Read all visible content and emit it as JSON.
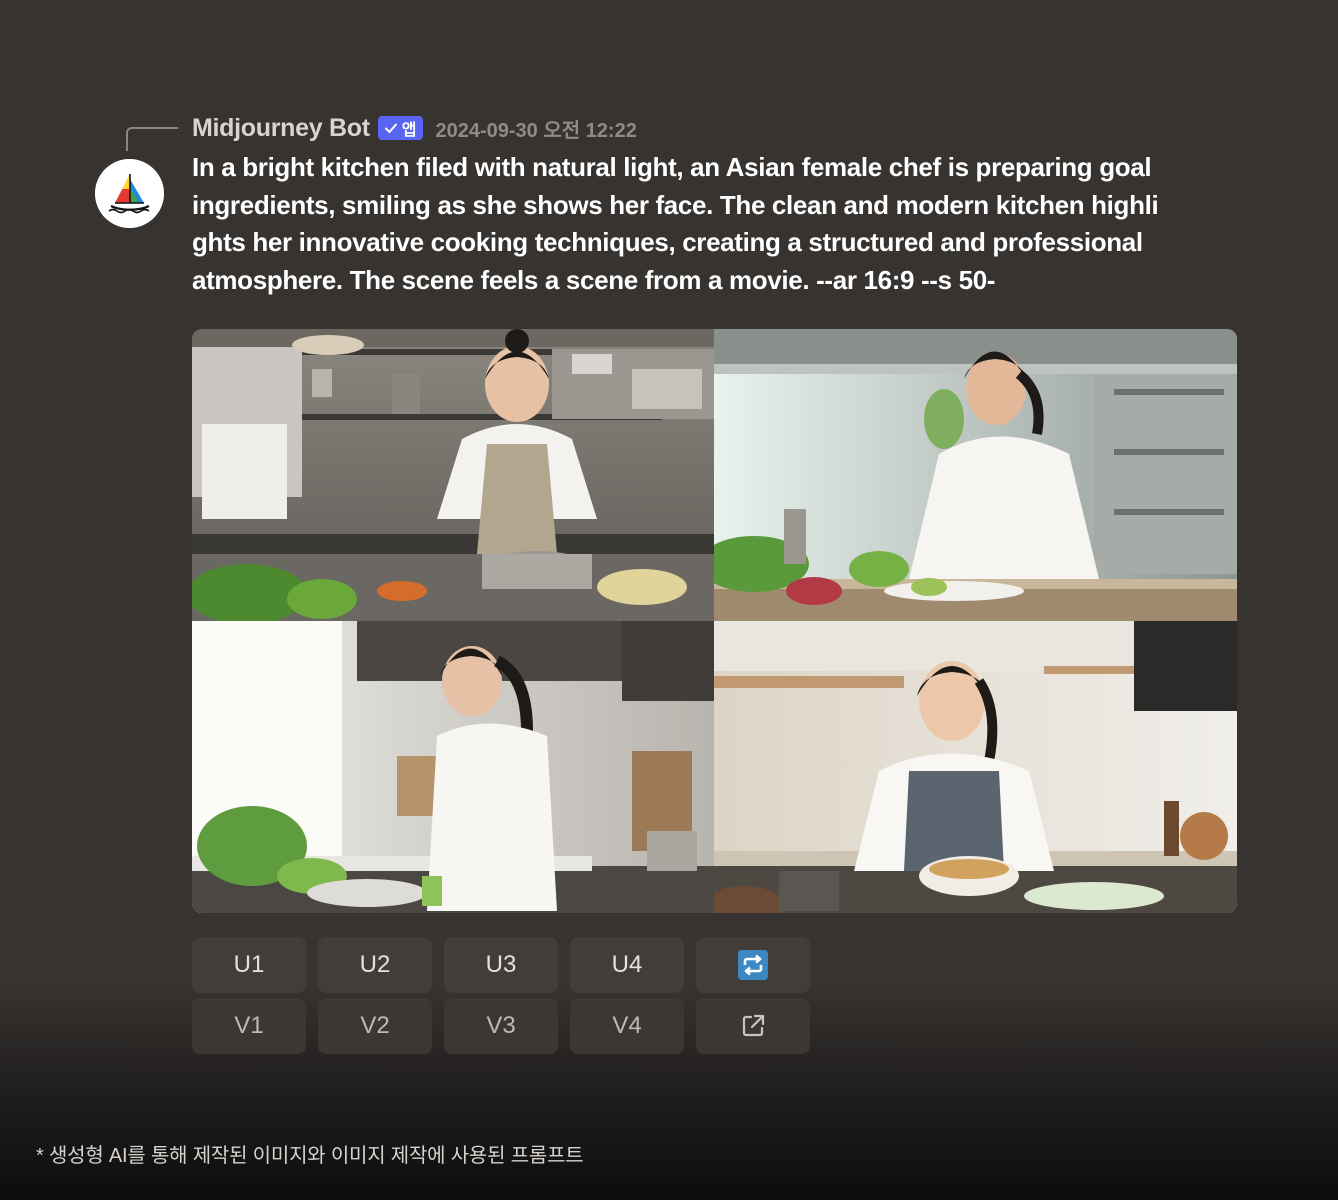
{
  "message": {
    "author": "Midjourney Bot",
    "badge_label": "앱",
    "timestamp": "2024-09-30 오전 12:22",
    "text": "In a bright kitchen filed with natural light, an Asian female chef is preparing goal\ningredients, smiling as she shows her face. The clean and modern kitchen highli\nghts her innovative cooking techniques, creating a structured and professional\natmosphere. The scene feels a scene from a movie. --ar 16:9 --s 50-"
  },
  "images": [
    {
      "icon": "kitchen-image-1"
    },
    {
      "icon": "kitchen-image-2"
    },
    {
      "icon": "kitchen-image-3"
    },
    {
      "icon": "kitchen-image-4"
    }
  ],
  "buttons": {
    "upscale": [
      "U1",
      "U2",
      "U3",
      "U4"
    ],
    "variation": [
      "V1",
      "V2",
      "V3",
      "V4"
    ],
    "reroll_icon": "reroll-icon",
    "open_icon": "external-link-icon"
  },
  "footnote": "* 생성형 AI를 통해 제작된 이미지와 이미지 제작에 사용된 프롬프트",
  "colors": {
    "background": "#363330",
    "badge": "#5865f2",
    "button": "#403d3b",
    "reroll": "#3b88c3"
  }
}
